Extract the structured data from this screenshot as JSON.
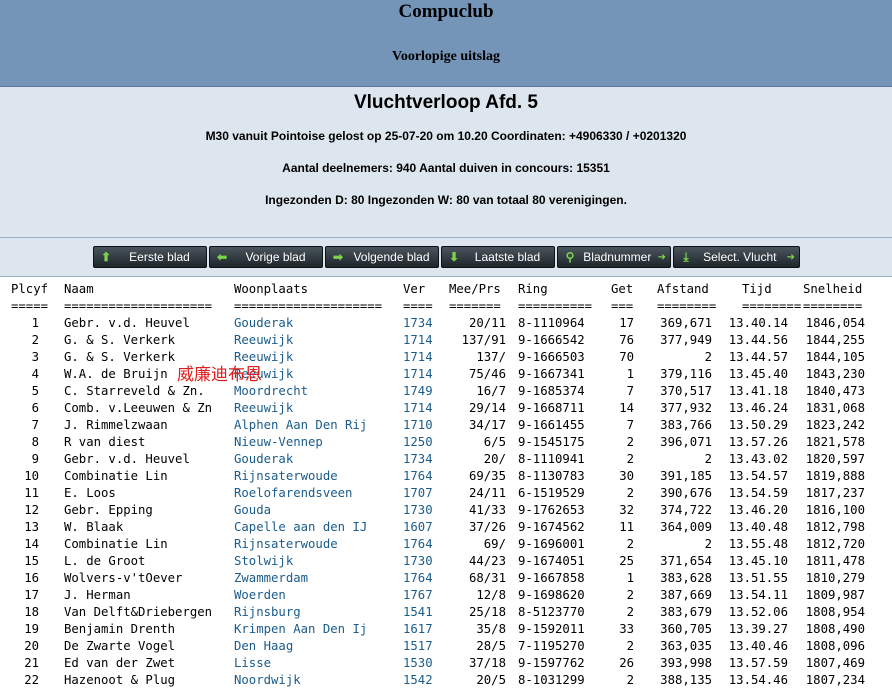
{
  "header": {
    "club": "Compuclub",
    "subtitle": "Voorlopige uitslag"
  },
  "info": {
    "title": "Vluchtverloop Afd. 5",
    "line1": "M30 vanuit Pointoise gelost op 25-07-20 om 10.20 Coordinaten: +4906330 / +0201320",
    "line2": "Aantal deelnemers: 940 Aantal duiven in concours: 15351",
    "line3": "Ingezonden D: 80 Ingezonden W: 80 van totaal 80 verenigingen."
  },
  "nav": {
    "first": "Eerste blad",
    "prev": "Vorige blad",
    "next": "Volgende blad",
    "last": "Laatste blad",
    "pagenr": "Bladnummer",
    "select": "Select. Vlucht"
  },
  "table": {
    "headers": [
      "Plcyf",
      "Naam",
      "Woonplaats",
      "Ver",
      "Mee/Prs",
      "Ring",
      "Get",
      "Afstand",
      "Tijd",
      "Snelheid"
    ],
    "separators": [
      "=====",
      "====================",
      "====================",
      "====",
      "=======",
      "==========",
      "===",
      "========",
      "========",
      "========"
    ],
    "rows": [
      [
        "1",
        "Gebr. v.d. Heuvel",
        "Gouderak",
        "1734",
        "20/11",
        "8-1110964",
        "17",
        "369,671",
        "13.40.14",
        "1846,054"
      ],
      [
        "2",
        "G. & S. Verkerk",
        "Reeuwijk",
        "1714",
        "137/91",
        "9-1666542",
        "76",
        "377,949",
        "13.44.56",
        "1844,255"
      ],
      [
        "3",
        "G. & S. Verkerk",
        "Reeuwijk",
        "1714",
        "137/",
        "9-1666503",
        "70",
        "2",
        "13.44.57",
        "1844,105"
      ],
      [
        "4",
        "W.A. de Bruijn",
        "Reeuwijk",
        "1714",
        "75/46",
        "9-1667341",
        "1",
        "379,116",
        "13.45.40",
        "1843,230"
      ],
      [
        "5",
        "C. Starreveld & Zn.",
        "Moordrecht",
        "1749",
        "16/7",
        "9-1685374",
        "7",
        "370,517",
        "13.41.18",
        "1840,473"
      ],
      [
        "6",
        "Comb. v.Leeuwen & Zn",
        "Reeuwijk",
        "1714",
        "29/14",
        "9-1668711",
        "14",
        "377,932",
        "13.46.24",
        "1831,068"
      ],
      [
        "7",
        "J. Rimmelzwaan",
        "Alphen Aan Den Rij",
        "1710",
        "34/17",
        "9-1661455",
        "7",
        "383,766",
        "13.50.29",
        "1823,242"
      ],
      [
        "8",
        "R van diest",
        "Nieuw-Vennep",
        "1250",
        "6/5",
        "9-1545175",
        "2",
        "396,071",
        "13.57.26",
        "1821,578"
      ],
      [
        "9",
        "Gebr. v.d. Heuvel",
        "Gouderak",
        "1734",
        "20/",
        "8-1110941",
        "2",
        "2",
        "13.43.02",
        "1820,597"
      ],
      [
        "10",
        "Combinatie Lin",
        "Rijnsaterwoude",
        "1764",
        "69/35",
        "8-1130783",
        "30",
        "391,185",
        "13.54.57",
        "1819,888"
      ],
      [
        "11",
        "E. Loos",
        "Roelofarendsveen",
        "1707",
        "24/11",
        "6-1519529",
        "2",
        "390,676",
        "13.54.59",
        "1817,237"
      ],
      [
        "12",
        "Gebr. Epping",
        "Gouda",
        "1730",
        "41/33",
        "9-1762653",
        "32",
        "374,722",
        "13.46.20",
        "1816,100"
      ],
      [
        "13",
        "W. Blaak",
        "Capelle aan den IJ",
        "1607",
        "37/26",
        "9-1674562",
        "11",
        "364,009",
        "13.40.48",
        "1812,798"
      ],
      [
        "14",
        "Combinatie Lin",
        "Rijnsaterwoude",
        "1764",
        "69/",
        "9-1696001",
        "2",
        "2",
        "13.55.48",
        "1812,720"
      ],
      [
        "15",
        "L. de Groot",
        "Stolwijk",
        "1730",
        "44/23",
        "9-1674051",
        "25",
        "371,654",
        "13.45.10",
        "1811,478"
      ],
      [
        "16",
        "Wolvers-v'tOever",
        "Zwammerdam",
        "1764",
        "68/31",
        "9-1667858",
        "1",
        "383,628",
        "13.51.55",
        "1810,279"
      ],
      [
        "17",
        "J. Herman",
        "Woerden",
        "1767",
        "12/8",
        "9-1698620",
        "2",
        "387,669",
        "13.54.11",
        "1809,987"
      ],
      [
        "18",
        "Van Delft&Driebergen",
        "Rijnsburg",
        "1541",
        "25/18",
        "8-5123770",
        "2",
        "383,679",
        "13.52.06",
        "1808,954"
      ],
      [
        "19",
        "Benjamin Drenth",
        "Krimpen Aan Den Ij",
        "1617",
        "35/8",
        "9-1592011",
        "33",
        "360,705",
        "13.39.27",
        "1808,490"
      ],
      [
        "20",
        "De Zwarte Vogel",
        "Den Haag",
        "1517",
        "28/5",
        "7-1195270",
        "2",
        "363,035",
        "13.40.46",
        "1808,096"
      ],
      [
        "21",
        "Ed van der Zwet",
        "Lisse",
        "1530",
        "37/18",
        "9-1597762",
        "26",
        "393,998",
        "13.57.59",
        "1807,469"
      ],
      [
        "22",
        "Hazenoot & Plug",
        "Noordwijk",
        "1542",
        "20/5",
        "8-1031299",
        "2",
        "388,135",
        "13.54.46",
        "1807,234"
      ]
    ]
  },
  "overlay_text": "威廉迪布恩"
}
